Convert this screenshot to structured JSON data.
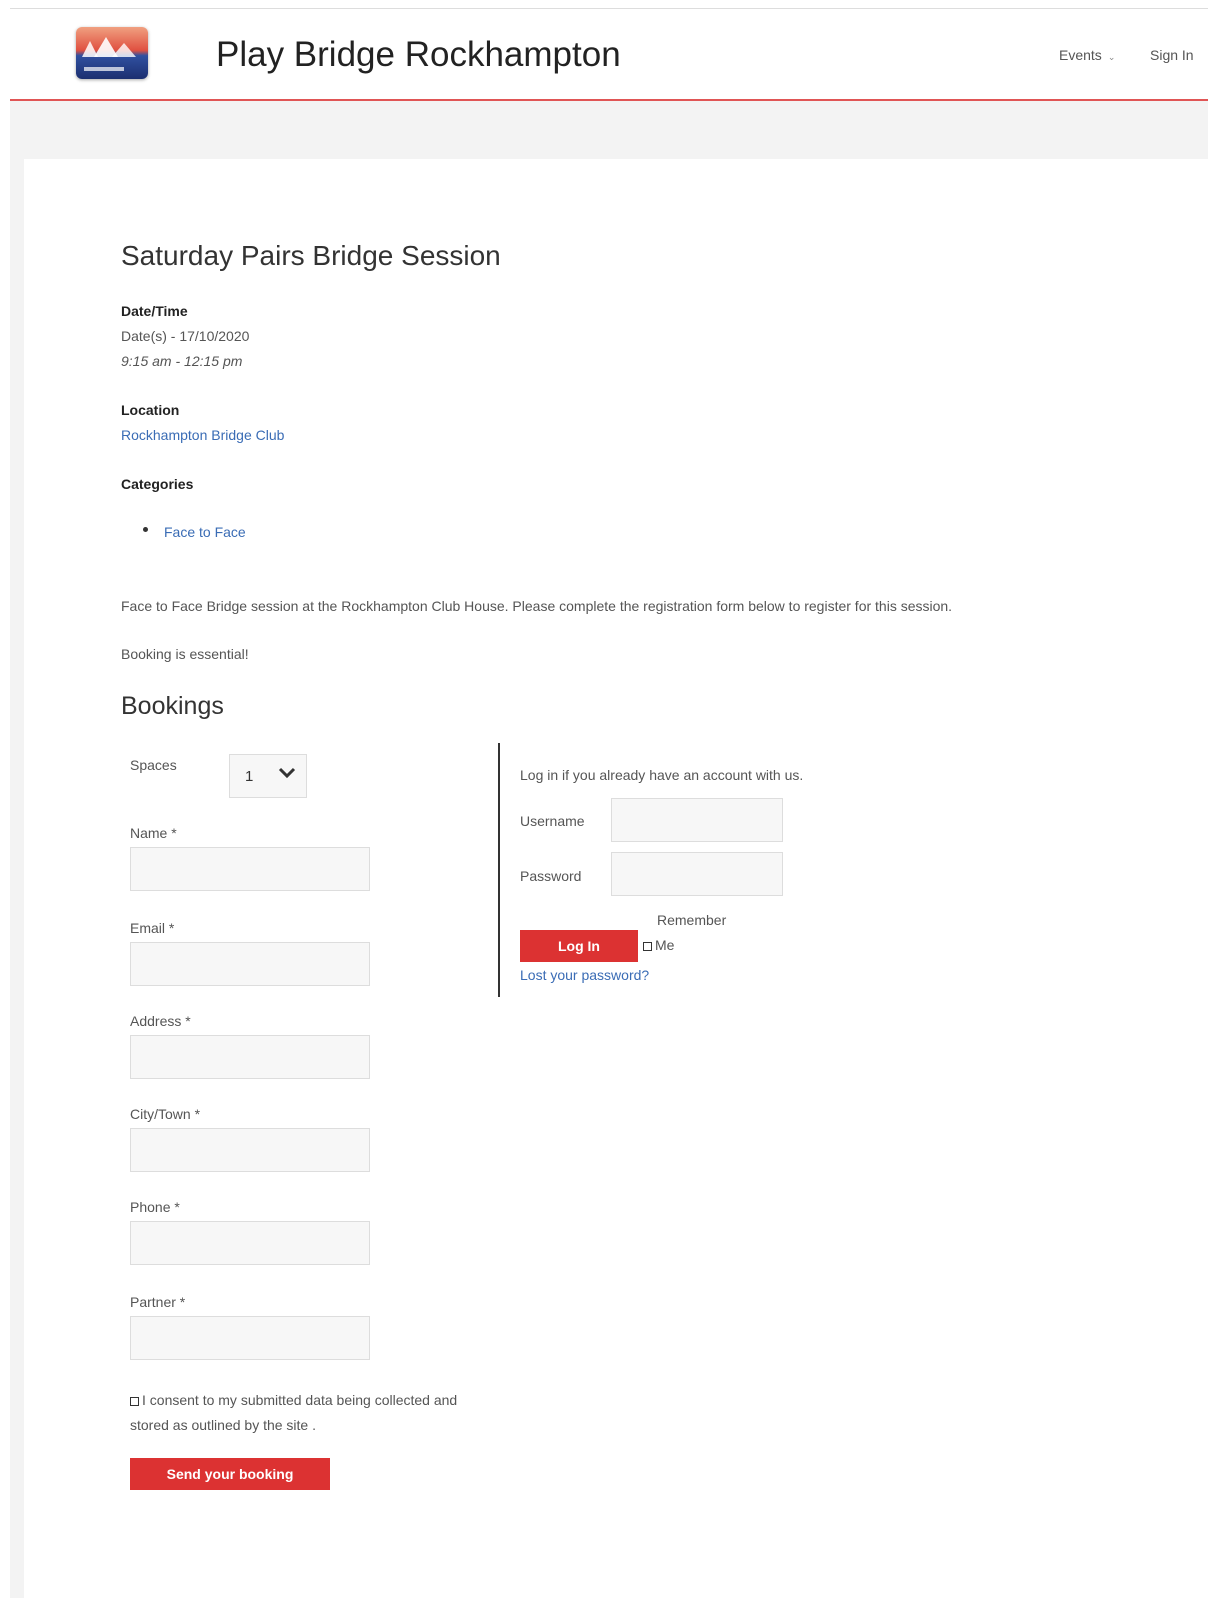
{
  "header": {
    "site_title": "Play Bridge Rockhampton",
    "nav": {
      "events": "Events",
      "sign_in": "Sign In"
    }
  },
  "event": {
    "title": "Saturday Pairs Bridge Session",
    "datetime_label": "Date/Time",
    "dates": "Date(s) - 17/10/2020",
    "time": "9:15 am - 12:15 pm",
    "location_label": "Location",
    "location": "Rockhampton Bridge Club",
    "categories_label": "Categories",
    "categories": [
      "Face to Face"
    ],
    "description": "Face to Face Bridge session at the Rockhampton Club House.  Please complete the registration form below to register for this session.",
    "note": "Booking is essential!"
  },
  "bookings": {
    "title": "Bookings",
    "spaces_label": "Spaces",
    "spaces_value": "1",
    "name_label": "Name *",
    "email_label": "Email *",
    "address_label": "Address *",
    "city_label": "City/Town *",
    "phone_label": "Phone *",
    "partner_label": "Partner *",
    "consent_text": "I consent to my submitted data being collected and stored as outlined by the site .",
    "submit_label": "Send your booking"
  },
  "login": {
    "intro": "Log in if you already have an account with us.",
    "username_label": "Username",
    "password_label": "Password",
    "login_button": "Log In",
    "remember_top": "Remember",
    "remember_bottom": "Me",
    "lost_password": "Lost your password?"
  },
  "colors": {
    "accent_red": "#dc3232",
    "header_border": "#e05555",
    "link_blue": "#3a6cb5",
    "gray_bg": "#f3f3f3"
  }
}
